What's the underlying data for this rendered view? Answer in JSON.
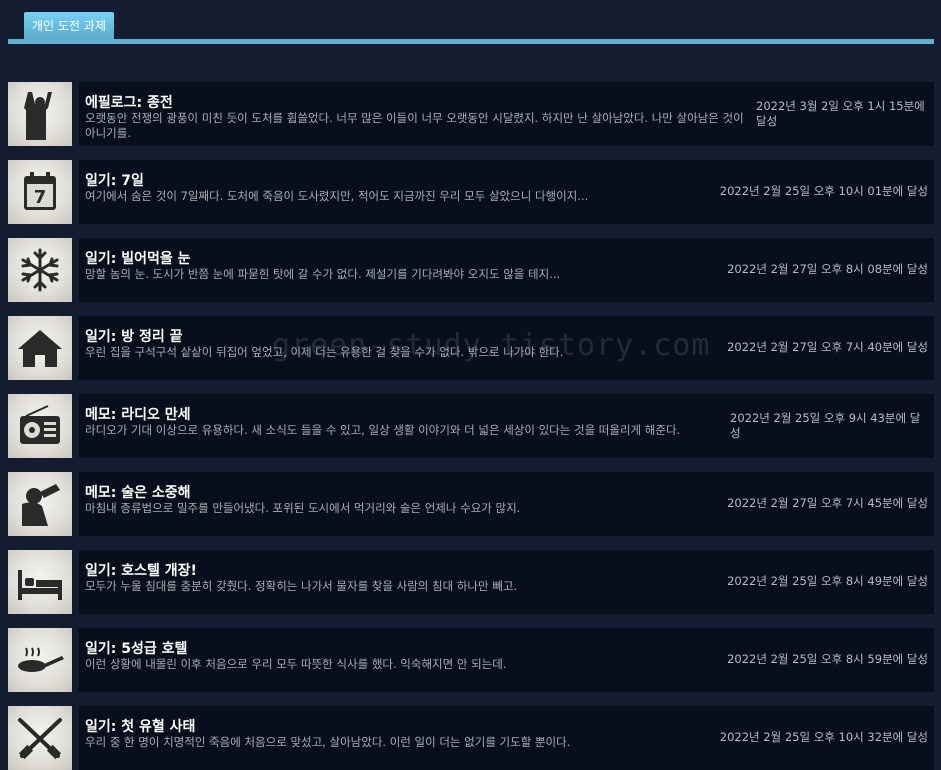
{
  "tab": {
    "label": "개인 도전 과제"
  },
  "watermark": "green-study.tistory.com",
  "achievements": [
    {
      "icon": "raised-fist-figure-icon",
      "title": "에필로그: 종전",
      "description": "오랫동안 전쟁의 광풍이 미친 듯이 도처를 휩쓸었다. 너무 많은 이들이 너무 오랫동안 시달렸지. 하지만 난 살아남았다. 나만 살아남은 것이 아니기를.",
      "date": "2022년 3월 2일 오후 1시 15분에 달성"
    },
    {
      "icon": "calendar-7-icon",
      "title": "일기: 7일",
      "description": "여기에서 숨은 것이 7일째다. 도처에 죽음이 도사렸지만, 적어도 지금까진 우리 모두 살았으니 다행이지...",
      "date": "2022년 2월 25일 오후 10시 01분에 달성"
    },
    {
      "icon": "snowflake-icon",
      "title": "일기: 빌어먹을 눈",
      "description": "망할 놈의 눈. 도시가 반쯤 눈에 파묻힌 탓에 갈 수가 없다. 제설기를 기다려봐야 오지도 않을 테지...",
      "date": "2022년 2월 27일 오후 8시 08분에 달성"
    },
    {
      "icon": "house-icon",
      "title": "일기: 방 정리 끝",
      "description": "우린 집을 구석구석 샅샅이 뒤집어 엎었고, 이제 더는 유용한 걸 찾을 수가 없다. 밖으로 나가야 한다.",
      "date": "2022년 2월 27일 오후 7시 40분에 달성"
    },
    {
      "icon": "radio-icon",
      "title": "메모: 라디오 만세",
      "description": "라디오가 기대 이상으로 유용하다. 새 소식도 들을 수 있고, 일상 생활 이야기와 더 넓은 세상이 있다는 것을 떠올리게 해준다.",
      "date": "2022년 2월 25일 오후 9시 43분에 달성"
    },
    {
      "icon": "drinking-figure-icon",
      "title": "메모: 술은 소중해",
      "description": "마침내 증류법으로 밀주를 만들어냈다. 포위된 도시에서 먹거리와 술은 언제나 수요가 많지.",
      "date": "2022년 2월 27일 오후 7시 45분에 달성"
    },
    {
      "icon": "bed-icon",
      "title": "일기: 호스텔 개장!",
      "description": "모두가 누울 침대를 충분히 갖췄다. 정확히는 나가서 물자를 찾을 사람의 침대 하나만 빼고.",
      "date": "2022년 2월 25일 오후 8시 49분에 달성"
    },
    {
      "icon": "frying-pan-icon",
      "title": "일기: 5성급 호텔",
      "description": "이런 상황에 내몰린 이후 처음으로 우리 모두 따뜻한 식사를 했다. 익숙해지면 안 되는데.",
      "date": "2022년 2월 25일 오후 8시 59분에 달성"
    },
    {
      "icon": "crossed-rifles-icon",
      "title": "일기: 첫 유혈 사태",
      "description": "우리 중 한 명이 치명적인 죽음에 처음으로 맞섰고, 살아남았다. 이런 일이 더는 없기를 기도할 뿐이다.",
      "date": "2022년 2월 25일 오후 10시 32분에 달성"
    }
  ]
}
